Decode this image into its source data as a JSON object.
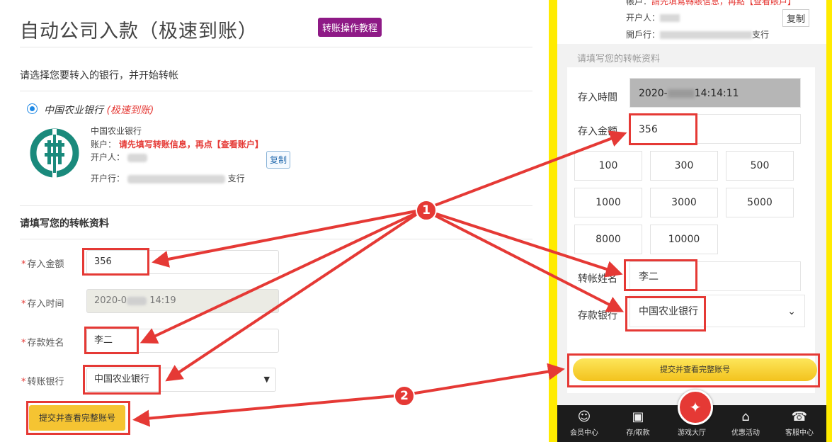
{
  "left": {
    "title": "自动公司入款（极速到账）",
    "tutorial_label": "转账操作教程",
    "subtitle": "请选择您要转入的银行，并开始转帐",
    "bank_choice": {
      "name": "中国农业银行",
      "fast": "(极速到账)"
    },
    "bank_info": {
      "name": "中国农业银行",
      "account_label": "账户：",
      "account_hint": "请先填写转账信息，再点【查看账户】",
      "holder_label": "开户人：",
      "branch_label": "开户行：",
      "branch_suffix": "支行",
      "copy_label": "复制"
    },
    "section_title": "请填写您的转帐资料",
    "form": {
      "amount_label": "存入金额",
      "amount_value": "356",
      "time_label": "存入时间",
      "time_prefix": "2020-0",
      "time_suffix": "14:19",
      "name_label": "存款姓名",
      "name_value": "李二",
      "bank_label": "转账银行",
      "bank_value": "中国农业银行"
    },
    "submit_label": "提交并查看完整账号"
  },
  "right": {
    "top": {
      "account_label": "帳戶：",
      "account_hint": "請先填寫轉賬信息，再點【查看賬戶】",
      "holder_label": "开户人：",
      "branch_label": "開戶行：",
      "branch_suffix": "支行",
      "copy_label": "复制"
    },
    "section_title": "请填写您的转帐资料",
    "time_label": "存入時間",
    "time_prefix": "2020-",
    "time_suffix": "14:14:11",
    "amount_label": "存入金额",
    "amount_value": "356",
    "amounts": [
      "100",
      "300",
      "500",
      "1000",
      "3000",
      "5000",
      "8000",
      "10000"
    ],
    "name_label": "转帐姓名",
    "name_value": "李二",
    "bank_label": "存款银行",
    "bank_value": "中国农业银行",
    "submit_label": "提交并查看完整账号",
    "tabs": [
      "会员中心",
      "存/取款",
      "游戏大厅",
      "优惠活动",
      "客服中心"
    ]
  },
  "badges": [
    "1",
    "2"
  ],
  "colors": {
    "annotation": "#e53935",
    "divider": "#ffeb00",
    "submit": "#f5c432",
    "tutorial": "#8e1a86"
  },
  "icons": [
    "radio-selected-icon",
    "abc-bank-logo-icon",
    "chevron-down-icon",
    "caret-down-icon",
    "member-icon",
    "wallet-icon",
    "gamepad-icon",
    "gift-icon",
    "support-icon"
  ]
}
